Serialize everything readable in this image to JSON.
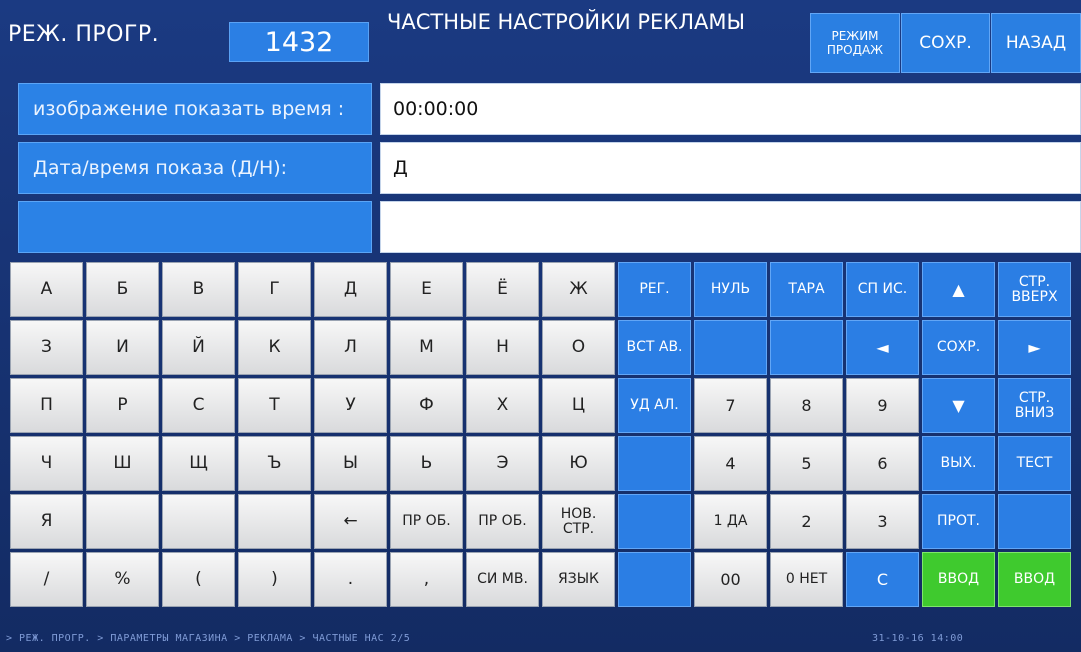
{
  "header": {
    "mode_label": "РЕЖ. ПРОГР.",
    "program_code": "1432",
    "title": "ЧАСТНЫЕ НАСТРОЙКИ РЕКЛАМЫ",
    "buttons": {
      "sales_mode": "РЕЖИМ ПРОДАЖ",
      "save": "СОХР.",
      "back": "НАЗАД"
    }
  },
  "form": {
    "rows": [
      {
        "label": "изображение показать время :",
        "value": "00:00:00"
      },
      {
        "label": "Дата/время показа (Д/Н):",
        "value": "Д"
      },
      {
        "label": "",
        "value": ""
      }
    ]
  },
  "keyboard": {
    "letters": [
      [
        "А",
        "Б",
        "В",
        "Г",
        "Д",
        "Е",
        "Ё",
        "Ж"
      ],
      [
        "З",
        "И",
        "Й",
        "К",
        "Л",
        "М",
        "Н",
        "О"
      ],
      [
        "П",
        "Р",
        "С",
        "Т",
        "У",
        "Ф",
        "Х",
        "Ц"
      ],
      [
        "Ч",
        "Ш",
        "Щ",
        "Ъ",
        "Ы",
        "Ь",
        "Э",
        "Ю"
      ],
      [
        "Я",
        "",
        "",
        "",
        "←",
        "ПР ОБ.",
        "ПР ОБ.",
        "НОВ. СТР."
      ],
      [
        "/",
        "%",
        "(",
        ")",
        ".",
        ",",
        "СИ МВ.",
        "ЯЗЫК"
      ]
    ],
    "right": [
      [
        "РЕГ.",
        "НУЛЬ",
        "ТАРА",
        "СП ИС.",
        "▲",
        "СТР. ВВЕРХ"
      ],
      [
        "ВСТ АВ.",
        "",
        "",
        "◄",
        "СОХР.",
        "►"
      ],
      [
        "УД АЛ.",
        "7",
        "8",
        "9",
        "▼",
        "СТР. ВНИЗ"
      ],
      [
        "",
        "4",
        "5",
        "6",
        "ВЫХ.",
        "ТЕСТ"
      ],
      [
        "",
        "1 ДА",
        "2",
        "3",
        "ПРОТ.",
        ""
      ],
      [
        "",
        "00",
        "0 НЕТ",
        "C",
        "ВВОД",
        "ВВОД"
      ]
    ]
  },
  "status": {
    "breadcrumb": "> РЕЖ. ПРОГР. > ПАРАМЕТРЫ МАГАЗИНА > РЕКЛАМА > ЧАСТНЫЕ НАС  2/5",
    "datetime": "31-10-16  14:00"
  },
  "colors": {
    "background": "#17306e",
    "accent_blue": "#2b7ee4",
    "enter_green": "#3fca2e",
    "key_light": "#e9eaeb"
  }
}
